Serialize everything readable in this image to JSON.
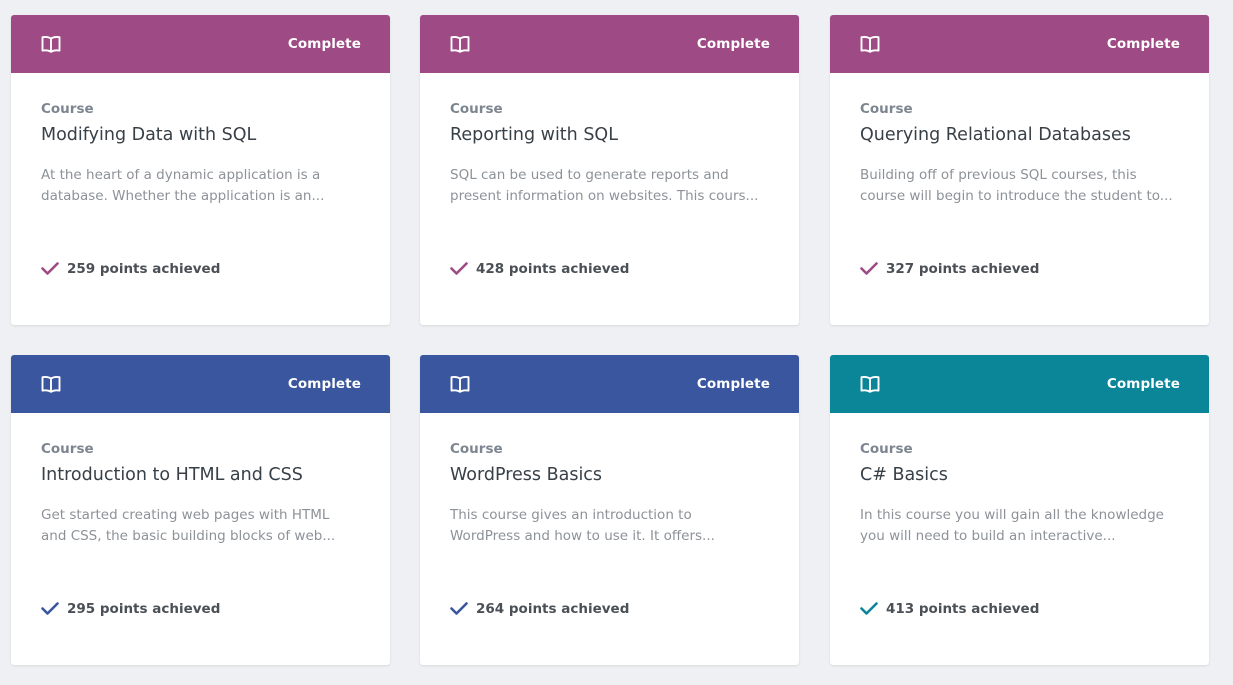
{
  "courses": [
    {
      "status": "Complete",
      "kind": "Course",
      "title": "Modifying Data with SQL",
      "desc_line1": "At the heart of a dynamic application is a",
      "desc_line2": "database. Whether the application is an...",
      "points": "259 points achieved",
      "color": "#9e4a84",
      "icon": "book-icon"
    },
    {
      "status": "Complete",
      "kind": "Course",
      "title": "Reporting with SQL",
      "desc_line1": "SQL can be used to generate reports and",
      "desc_line2": "present information on websites. This cours...",
      "points": "428 points achieved",
      "color": "#9e4a84",
      "icon": "book-icon"
    },
    {
      "status": "Complete",
      "kind": "Course",
      "title": "Querying Relational Databases",
      "desc_line1": "Building off of previous SQL courses, this",
      "desc_line2": "course will begin to introduce the student to...",
      "points": "327 points achieved",
      "color": "#9e4a84",
      "icon": "book-icon"
    },
    {
      "status": "Complete",
      "kind": "Course",
      "title": "Introduction to HTML and CSS",
      "desc_line1": "Get started creating web pages with HTML",
      "desc_line2": "and CSS, the basic building blocks of web...",
      "points": "295 points achieved",
      "color": "#39569e",
      "icon": "book-icon"
    },
    {
      "status": "Complete",
      "kind": "Course",
      "title": "WordPress Basics",
      "desc_line1": "This course gives an introduction to",
      "desc_line2": "WordPress and how to use it. It offers...",
      "points": "264 points achieved",
      "color": "#39569e",
      "icon": "book-icon"
    },
    {
      "status": "Complete",
      "kind": "Course",
      "title": "C# Basics",
      "desc_line1": "In this course you will gain all the knowledge",
      "desc_line2": "you will need to build an interactive...",
      "points": "413 points achieved",
      "color": "#0b8598",
      "icon": "book-icon"
    }
  ]
}
